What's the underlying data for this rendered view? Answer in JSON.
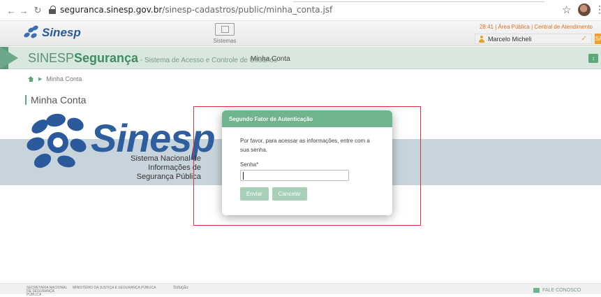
{
  "browser": {
    "url_host": "seguranca.sinesp.gov.br",
    "url_path": "/sinesp-cadastros/public/minha_conta.jsf"
  },
  "header": {
    "logo_text": "Sinesp",
    "sistemas_label": "Sistemas",
    "top_links": "28:41 | Área Pública | Central de Atendimento",
    "user_name": "Marcelo Micheli",
    "sair_label": "SAIR"
  },
  "nav": {
    "brand_main": "SINESP",
    "brand_bold": "Segurança",
    "brand_sub": " - Sistema de Acesso e Controle de Usuários",
    "item": "Minha Conta"
  },
  "breadcrumb": {
    "current": "Minha Conta"
  },
  "page": {
    "title": "Minha Conta"
  },
  "banner": {
    "logo_text": "Sinesp",
    "subtitle_line1": "Sistema Nacional de Informações de",
    "subtitle_line2": "Segurança Pública"
  },
  "modal": {
    "title": "Segundo Fator de Autenticação",
    "message": "Por favor, para acessar as informações, entre com a sua senha.",
    "field_label": "Senha*",
    "password_value": "",
    "submit_label": "Enviar",
    "cancel_label": "Cancelar"
  },
  "footer": {
    "org1": "SECRETARIA NACIONAL DE SEGURANÇA PÚBLICA",
    "org2": "MINISTÉRIO DA JUSTIÇA E SEGURANÇA PÚBLICA",
    "solution": "Solução",
    "contact": "FALE CONOSCO"
  },
  "colors": {
    "accent_green": "#6fb48c",
    "brand_blue": "#2e5e9e",
    "highlight_red": "#e1303d"
  }
}
